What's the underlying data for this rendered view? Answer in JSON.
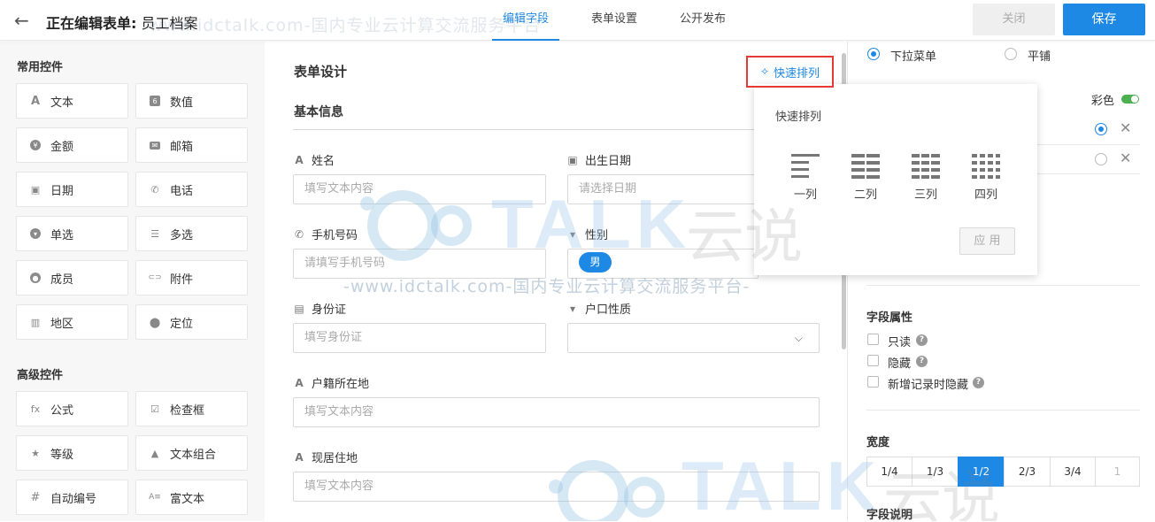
{
  "header": {
    "back_icon": "arrow-left-icon",
    "title_prefix": "正在编辑表单:",
    "title_name": "员工档案",
    "tabs": [
      {
        "label": "编辑字段",
        "active": true
      },
      {
        "label": "表单设置",
        "active": false
      },
      {
        "label": "公开发布",
        "active": false
      }
    ],
    "close_label": "关闭",
    "save_label": "保存",
    "accent_color": "#1e88e5"
  },
  "watermark": {
    "top": "www.idctalk.com-国内专业云计算交流服务平台",
    "mid": "-www.idctalk.com-国内专业云计算交流服务平台-",
    "logo": "TALK",
    "logo_cn": "云说"
  },
  "sidebar": {
    "common_title": "常用控件",
    "common": [
      {
        "label": "文本",
        "icon": "A"
      },
      {
        "label": "数值",
        "icon": "6"
      },
      {
        "label": "金额",
        "icon": "¥"
      },
      {
        "label": "邮箱",
        "icon": "✉"
      },
      {
        "label": "日期",
        "icon": "▣"
      },
      {
        "label": "电话",
        "icon": "✆"
      },
      {
        "label": "单选",
        "icon": "▾"
      },
      {
        "label": "多选",
        "icon": "☰"
      },
      {
        "label": "成员",
        "icon": "●"
      },
      {
        "label": "附件",
        "icon": "⊂⊃"
      },
      {
        "label": "地区",
        "icon": "▥"
      },
      {
        "label": "定位",
        "icon": "⬤"
      }
    ],
    "advanced_title": "高级控件",
    "advanced": [
      {
        "label": "公式",
        "icon": "fx"
      },
      {
        "label": "检查框",
        "icon": "☑"
      },
      {
        "label": "等级",
        "icon": "★"
      },
      {
        "label": "文本组合",
        "icon": "▲"
      },
      {
        "label": "自动编号",
        "icon": "#"
      },
      {
        "label": "富文本",
        "icon": "A≡"
      }
    ]
  },
  "form": {
    "title": "表单设计",
    "quick_arrange_label": "快速排列",
    "group_title": "基本信息",
    "fields": [
      {
        "label": "姓名",
        "icon": "A",
        "placeholder": "填写文本内容"
      },
      {
        "label": "出生日期",
        "icon": "▣",
        "placeholder": "请选择日期"
      },
      {
        "label": "手机号码",
        "icon": "✆",
        "placeholder": "请填写手机号码"
      },
      {
        "label": "性别",
        "icon": "▾",
        "value": "男"
      },
      {
        "label": "身份证",
        "icon": "▤",
        "placeholder": "填写身份证"
      },
      {
        "label": "户口性质",
        "icon": "▾",
        "placeholder": ""
      },
      {
        "label": "户籍所在地",
        "icon": "A",
        "placeholder": "填写文本内容"
      },
      {
        "label": "现居住地",
        "icon": "A",
        "placeholder": "填写文本内容"
      }
    ]
  },
  "popup": {
    "title": "快速排列",
    "options": [
      "一列",
      "二列",
      "三列",
      "四列"
    ],
    "apply_label": "应 用"
  },
  "props": {
    "display_options": [
      {
        "label": "下拉菜单",
        "selected": true
      },
      {
        "label": "平铺",
        "selected": false
      }
    ],
    "color_label": "彩色",
    "color_on": true,
    "field_attr_title": "字段属性",
    "checkboxes": [
      "只读",
      "隐藏",
      "新增记录时隐藏"
    ],
    "width_title": "宽度",
    "widths": [
      {
        "label": "1/4",
        "active": false,
        "disabled": false
      },
      {
        "label": "1/3",
        "active": false,
        "disabled": false
      },
      {
        "label": "1/2",
        "active": true,
        "disabled": false
      },
      {
        "label": "2/3",
        "active": false,
        "disabled": false
      },
      {
        "label": "3/4",
        "active": false,
        "disabled": false
      },
      {
        "label": "1",
        "active": false,
        "disabled": true
      }
    ],
    "desc_title": "字段说明"
  }
}
